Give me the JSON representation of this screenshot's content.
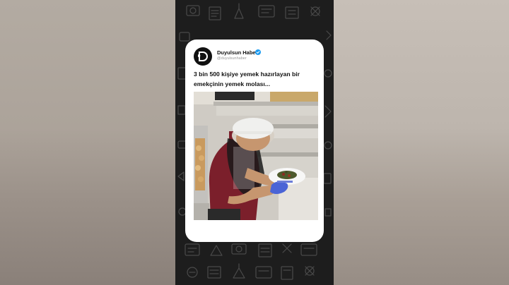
{
  "post": {
    "account_name": "Duyulsun Haber",
    "account_handle": "@duyulsunhaber",
    "caption": "3 bin 500 kişiye yemek hazırlayan bir emekçinin yemek molası...",
    "verified_icon": "verified-badge-icon",
    "avatar_icon": "duyulsun-logo-icon"
  },
  "colors": {
    "verified": "#1d9bf0",
    "frame_bg": "#1d1d1d",
    "card_bg": "#ffffff"
  }
}
